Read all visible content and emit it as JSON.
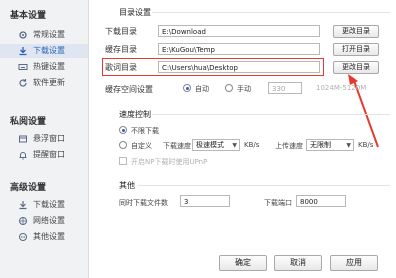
{
  "sidebar": {
    "sections": [
      {
        "title": "基本设置",
        "items": [
          {
            "label": "常规设置",
            "icon": "gear-icon"
          },
          {
            "label": "下载设置",
            "icon": "download-icon",
            "active": true
          },
          {
            "label": "热键设置",
            "icon": "keyboard-icon"
          },
          {
            "label": "软件更新",
            "icon": "update-icon"
          }
        ]
      },
      {
        "title": "私阅设置",
        "items": [
          {
            "label": "悬浮窗口",
            "icon": "window-icon"
          },
          {
            "label": "提醒窗口",
            "icon": "bell-icon"
          }
        ]
      },
      {
        "title": "高级设置",
        "items": [
          {
            "label": "下载设置",
            "icon": "download-icon"
          },
          {
            "label": "网络设置",
            "icon": "network-icon"
          },
          {
            "label": "其他设置",
            "icon": "other-icon"
          }
        ]
      }
    ]
  },
  "directory": {
    "title": "目录设置",
    "download_label": "下载目录",
    "download_path": "E:\\Download",
    "temp_label": "缓存目录",
    "temp_path": "E:\\KuGou\\Temp",
    "lyrics_label": "歌词目录",
    "lyrics_path": "C:\\Users\\hua\\Desktop",
    "change_button": "更改目录",
    "open_button": "打开目录",
    "change_button_3": "更改目录"
  },
  "cache": {
    "label": "缓存空间设置",
    "auto": "自动",
    "manual": "手动",
    "size_value": "330",
    "range_hint": "1024M-5120M"
  },
  "speed": {
    "title": "速度控制",
    "unlimited": "不限下载",
    "custom": "自定义",
    "download_label": "下载速度",
    "download_value": "极速模式",
    "unit_down": "KB/s",
    "upload_label": "上传速度",
    "upload_value": "无限制",
    "unit_up": "KB/s",
    "note": "开启NP下载时使用UPnP"
  },
  "other": {
    "title": "其他",
    "concurrent_label": "同时下载文件数",
    "concurrent_value": "3",
    "port_label": "下载端口",
    "port_value": "8000"
  },
  "footer": {
    "ok": "确定",
    "cancel": "取消",
    "apply": "应用"
  },
  "colors": {
    "accent": "#2b63b8",
    "highlight": "#e8392e"
  }
}
